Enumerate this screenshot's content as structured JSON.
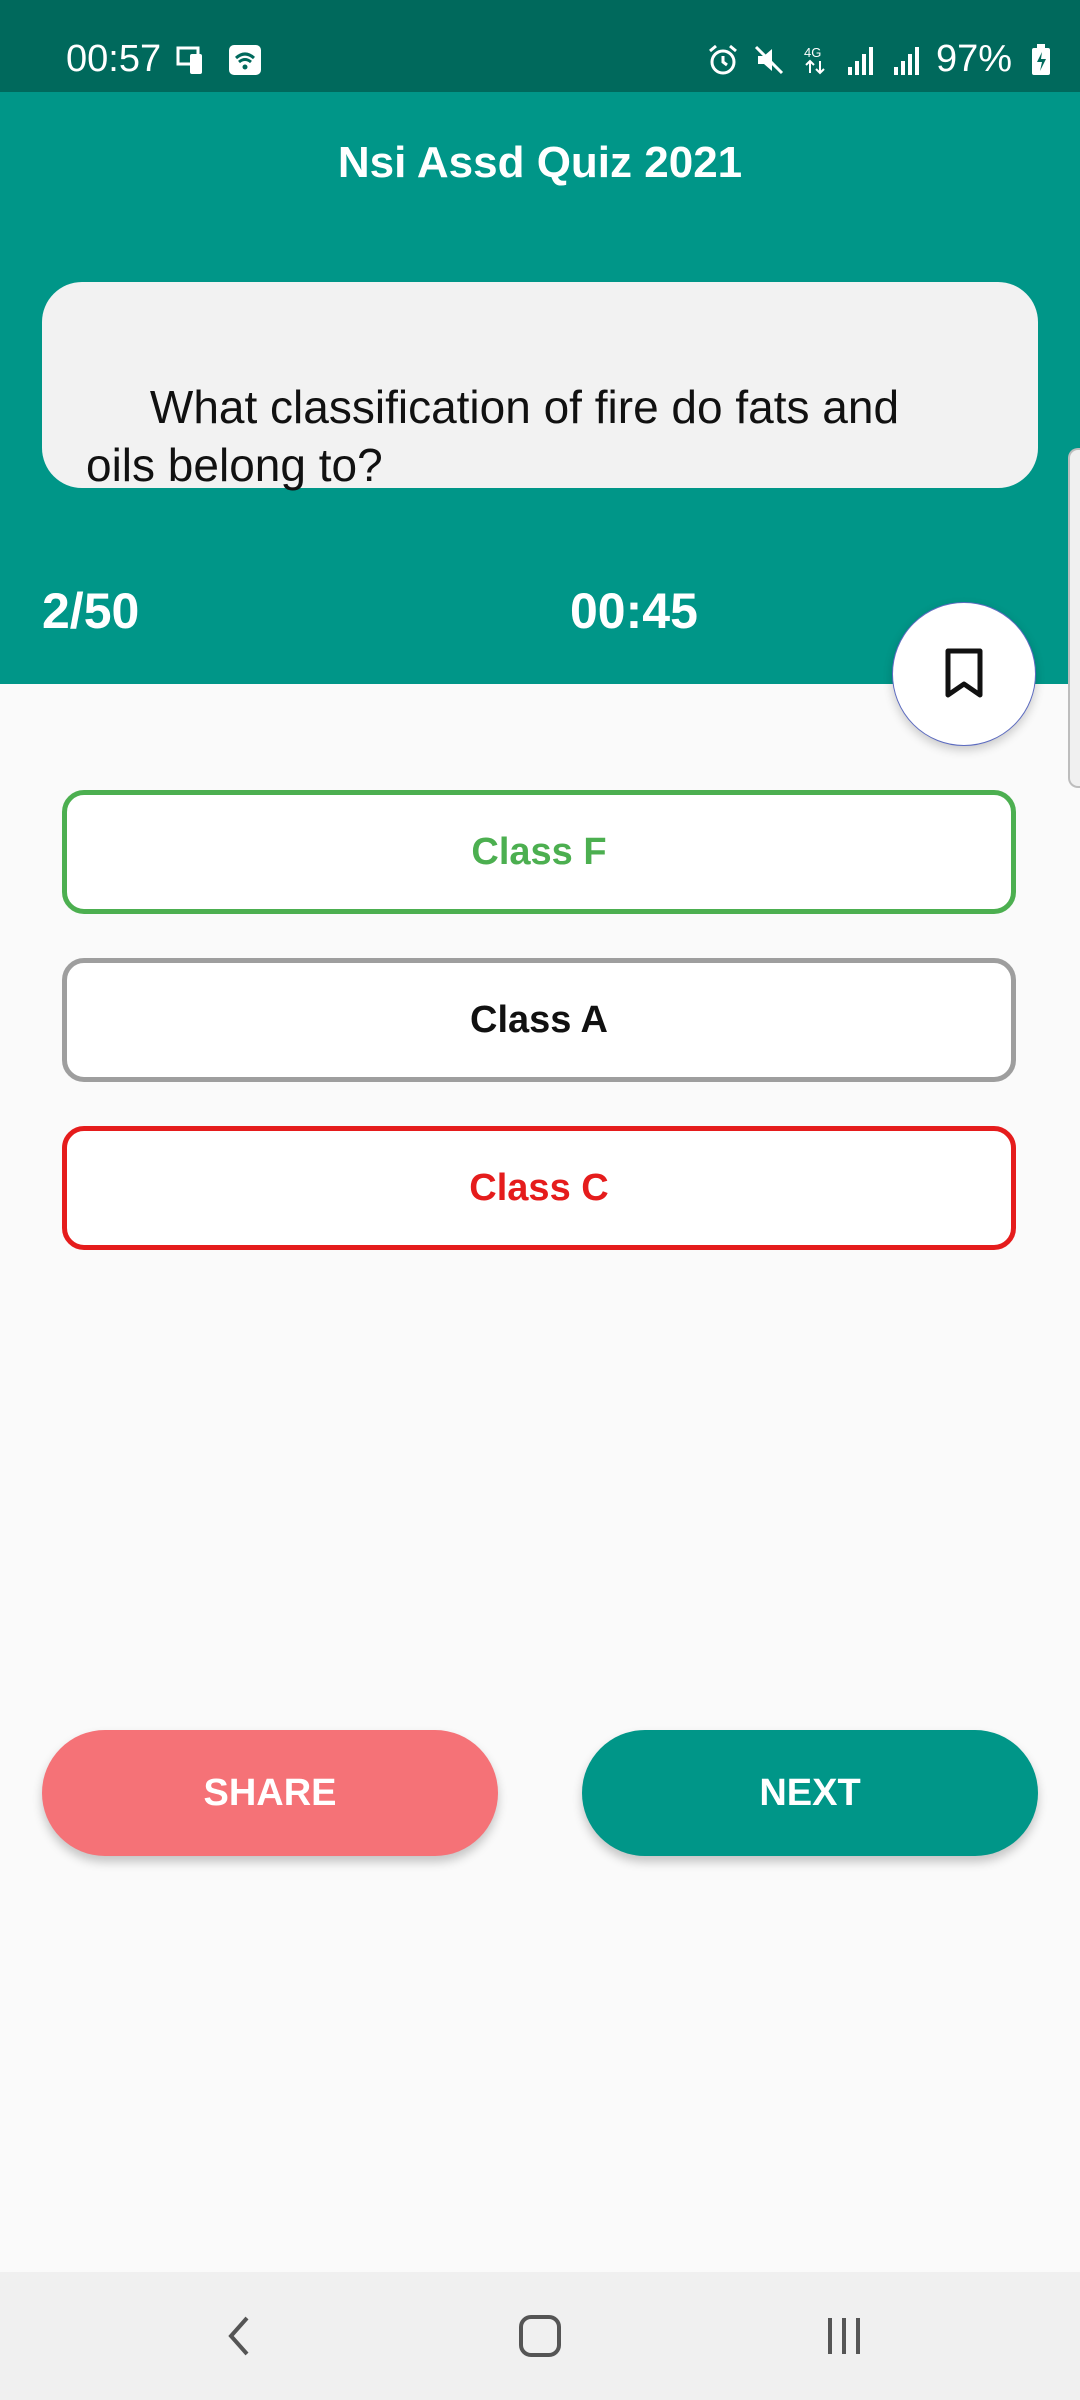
{
  "status_bar": {
    "time": "00:57",
    "battery": "97%",
    "network": "4G",
    "icons": [
      "screen-mirror-icon",
      "wifi-calling-icon",
      "alarm-icon",
      "mute-icon",
      "data-arrows-icon",
      "signal-icon",
      "signal-icon",
      "battery-charging-icon"
    ]
  },
  "header": {
    "title": "Nsi Assd Quiz 2021",
    "question": " What classification of fire do fats and\noils belong to?",
    "counter": "2/50",
    "timer": "00:45",
    "bookmark_icon": "bookmark-icon"
  },
  "options": [
    {
      "label": "Class F",
      "state": "correct",
      "color": "#4caf50"
    },
    {
      "label": "Class A",
      "state": "neutral",
      "color": "#9e9e9e"
    },
    {
      "label": "Class C",
      "state": "wrong",
      "color": "#e51c1c"
    }
  ],
  "actions": {
    "share_label": "SHARE",
    "next_label": "NEXT"
  },
  "colors": {
    "primary": "#009688",
    "primary_dark": "#00695c",
    "share": "#f57277"
  },
  "nav": {
    "icons": [
      "back-icon",
      "home-icon",
      "recents-icon"
    ]
  }
}
